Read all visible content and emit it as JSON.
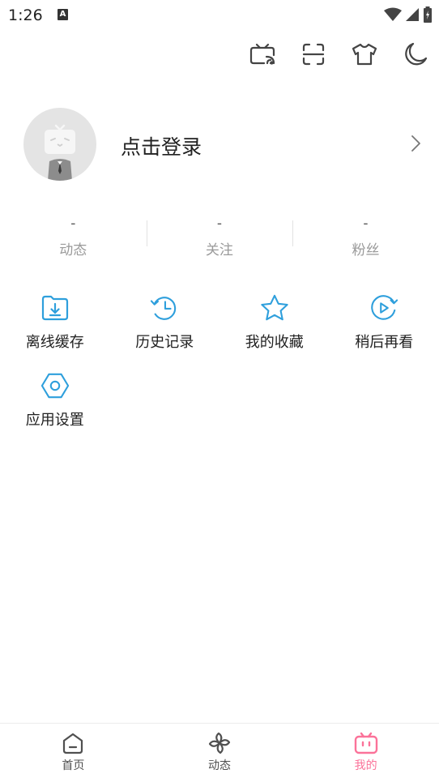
{
  "status_bar": {
    "time": "1:26",
    "notification_badge": "A",
    "icons": [
      "wifi-icon",
      "signal-icon",
      "battery-icon"
    ]
  },
  "toolbar": {
    "icons": [
      "tv-cast-icon",
      "scan-icon",
      "shirt-icon",
      "moon-icon"
    ]
  },
  "profile": {
    "login_text": "点击登录"
  },
  "stats": [
    {
      "value": "-",
      "label": "动态"
    },
    {
      "value": "-",
      "label": "关注"
    },
    {
      "value": "-",
      "label": "粉丝"
    }
  ],
  "features": [
    {
      "label": "离线缓存",
      "icon": "download-folder-icon"
    },
    {
      "label": "历史记录",
      "icon": "history-clock-icon"
    },
    {
      "label": "我的收藏",
      "icon": "star-icon"
    },
    {
      "label": "稍后再看",
      "icon": "watch-later-icon"
    },
    {
      "label": "应用设置",
      "icon": "settings-hexagon-icon"
    }
  ],
  "bottom_nav": [
    {
      "label": "首页",
      "icon": "home-icon"
    },
    {
      "label": "动态",
      "icon": "pinwheel-icon"
    },
    {
      "label": "我的",
      "icon": "bilibili-tv-icon",
      "active": true
    }
  ],
  "colors": {
    "accent_blue": "#2e9fdc",
    "accent_pink": "#fb7299",
    "icon_gray": "#444444",
    "avatar_bg": "#e4e4e4"
  }
}
